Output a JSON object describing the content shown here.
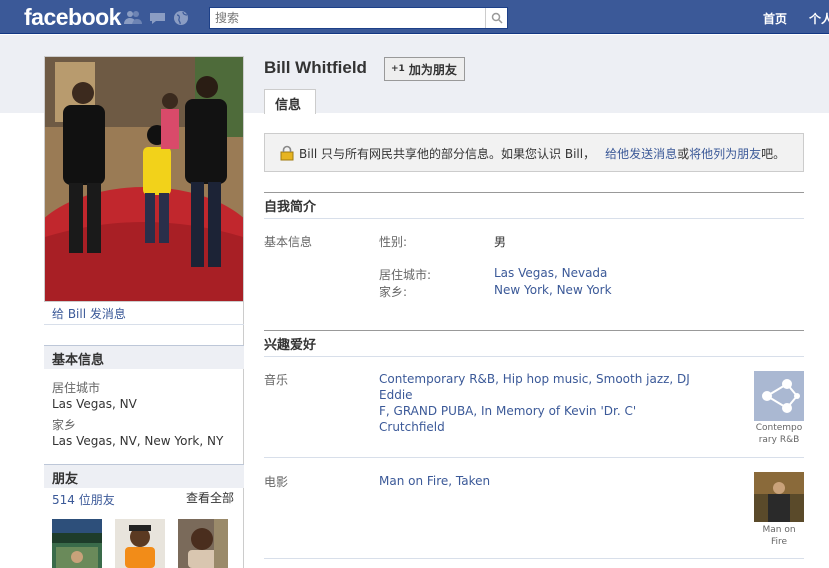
{
  "topbar": {
    "logo": "facebook",
    "search_placeholder": "搜索",
    "nav_home": "首页",
    "nav_profile": "个人"
  },
  "profile": {
    "name": "Bill Whitfield",
    "add_friend_label": "加为朋友",
    "add_friend_prefix": "+1",
    "tab_info": "信息",
    "message_link": "给 Bill 发消息"
  },
  "notice": {
    "text": "Bill 只与所有网民共享他的部分信息。如果您认识 Bill，",
    "link_message": "给他发送消息",
    "or": "或",
    "link_friend": "将他列为朋友",
    "suffix": "吧。"
  },
  "sidebar": {
    "basic_info_title": "基本信息",
    "city_label": "居住城市",
    "city_value": "Las Vegas, NV",
    "hometown_label": "家乡",
    "hometown_value": "Las Vegas, NV, New York, NY",
    "friends_title": "朋友",
    "friends_count": "514 位朋友",
    "see_all": "查看全部"
  },
  "about": {
    "title": "自我简介",
    "basic_label": "基本信息",
    "gender_label": "性别:",
    "gender_value": "男",
    "city_label": "居住城市:",
    "city_value": "Las Vegas, Nevada",
    "hometown_label": "家乡:",
    "hometown_value": "New York, New York"
  },
  "interests": {
    "title": "兴趣爱好",
    "music_label": "音乐",
    "music_line1": "Contemporary R&B, Hip hop music, Smooth jazz, DJ Eddie",
    "music_line2": "F, GRAND PUBA, In Memory of Kevin 'Dr. C' Crutchfield",
    "music_thumb_caption_1": "Contempo",
    "music_thumb_caption_2": "rary R&B",
    "movies_label": "电影",
    "movies_value": "Man on Fire, Taken",
    "movie_thumb_caption_1": "Man on",
    "movie_thumb_caption_2": "Fire"
  },
  "colors": {
    "brand": "#3b5998",
    "link": "#3b5998",
    "panel_bg": "#edeff4"
  }
}
